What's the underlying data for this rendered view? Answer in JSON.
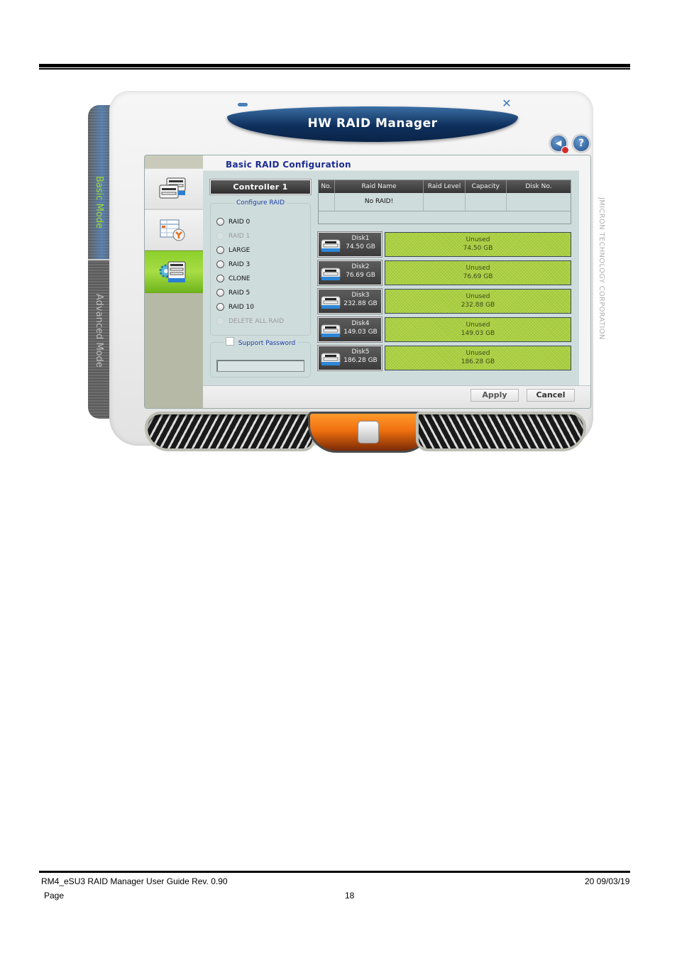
{
  "app": {
    "title": "HW RAID Manager",
    "vendor_text": "JMICRON TECHNOLOGY CORPORATION",
    "window_controls": {
      "minimize_icon": "minimize-icon",
      "close_icon": "close-icon",
      "close_glyph": "✕"
    },
    "top_icons": [
      {
        "name": "sound-mute-icon",
        "glyph": "◀"
      },
      {
        "name": "help-icon",
        "glyph": "?"
      }
    ],
    "mode_rail": {
      "basic_label": "Basic Mode",
      "advanced_label": "Advanced Mode",
      "active": "Basic Mode"
    },
    "tabs": [
      {
        "name": "disk-info-tab",
        "icon": "disks-icon",
        "active": false
      },
      {
        "name": "schedule-tab",
        "icon": "calendar-clock-icon",
        "active": false
      },
      {
        "name": "raid-config-tab",
        "icon": "gear-disk-icon",
        "active": true
      }
    ],
    "section_title": "Basic RAID Configuration",
    "controller_label": "Controller 1",
    "configure_raid": {
      "legend": "Configure RAID",
      "options": [
        {
          "label": "RAID 0",
          "enabled": true
        },
        {
          "label": "RAID 1",
          "enabled": false
        },
        {
          "label": "LARGE",
          "enabled": true
        },
        {
          "label": "RAID 3",
          "enabled": true
        },
        {
          "label": "CLONE",
          "enabled": true
        },
        {
          "label": "RAID 5",
          "enabled": true
        },
        {
          "label": "RAID 10",
          "enabled": true
        },
        {
          "label": "DELETE ALL RAID",
          "enabled": false
        }
      ]
    },
    "password": {
      "checkbox_label": "Support Password",
      "checked": false,
      "value": ""
    },
    "raid_table": {
      "columns": [
        "No.",
        "Raid Name",
        "Raid Level",
        "Capacity",
        "Disk No."
      ],
      "rows": [
        [
          "",
          "No RAID!",
          "",
          "",
          ""
        ]
      ]
    },
    "disks": [
      {
        "name": "Disk1",
        "size": "74.50 GB",
        "status": "Unused",
        "status_size": "74.50 GB"
      },
      {
        "name": "Disk2",
        "size": "76.69 GB",
        "status": "Unused",
        "status_size": "76.69 GB"
      },
      {
        "name": "Disk3",
        "size": "232.88 GB",
        "status": "Unused",
        "status_size": "232.88 GB"
      },
      {
        "name": "Disk4",
        "size": "149.03 GB",
        "status": "Unused",
        "status_size": "149.03 GB"
      },
      {
        "name": "Disk5",
        "size": "186.28 GB",
        "status": "Unused",
        "status_size": "186.28 GB"
      }
    ],
    "buttons": {
      "apply": "Apply",
      "cancel": "Cancel"
    },
    "colors": {
      "unused_bar": "#a9cf3b",
      "active_tab": "#8ccf2b",
      "title_blue": "#0e2f5c",
      "section_title": "#1b2c8f"
    }
  },
  "footer": {
    "doc_title": "RM4_eSU3 RAID Manager User Guide Rev. 0.90",
    "date": "20  09/03/19",
    "page_label": "Page",
    "page_number": "18"
  }
}
